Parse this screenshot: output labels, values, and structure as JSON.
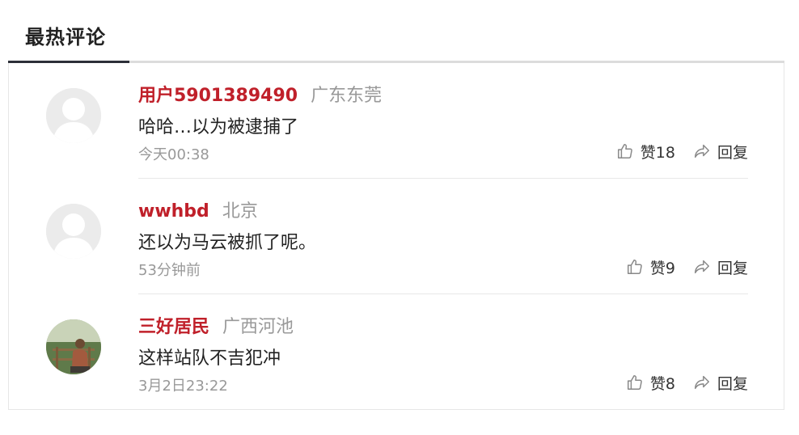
{
  "header": {
    "title": "最热评论"
  },
  "comments": [
    {
      "user": "用户5901389490",
      "location": "广东东莞",
      "content": "哈哈…以为被逮捕了",
      "time": "今天00:38",
      "like_label": "赞18",
      "reply_label": "回复",
      "avatar": "default-avatar"
    },
    {
      "user": "wwhbd",
      "location": "北京",
      "content": "还以为马云被抓了呢。",
      "time": "53分钟前",
      "like_label": "赞9",
      "reply_label": "回复",
      "avatar": "default-avatar"
    },
    {
      "user": "三好居民",
      "location": "广西河池",
      "content": "这样站队不吉犯冲",
      "time": "3月2日23:22",
      "like_label": "赞8",
      "reply_label": "回复",
      "avatar": "photo-avatar"
    }
  ],
  "colors": {
    "accent_red": "#c0202a",
    "muted_gray": "#999999",
    "tab_active": "#2c2f38"
  }
}
